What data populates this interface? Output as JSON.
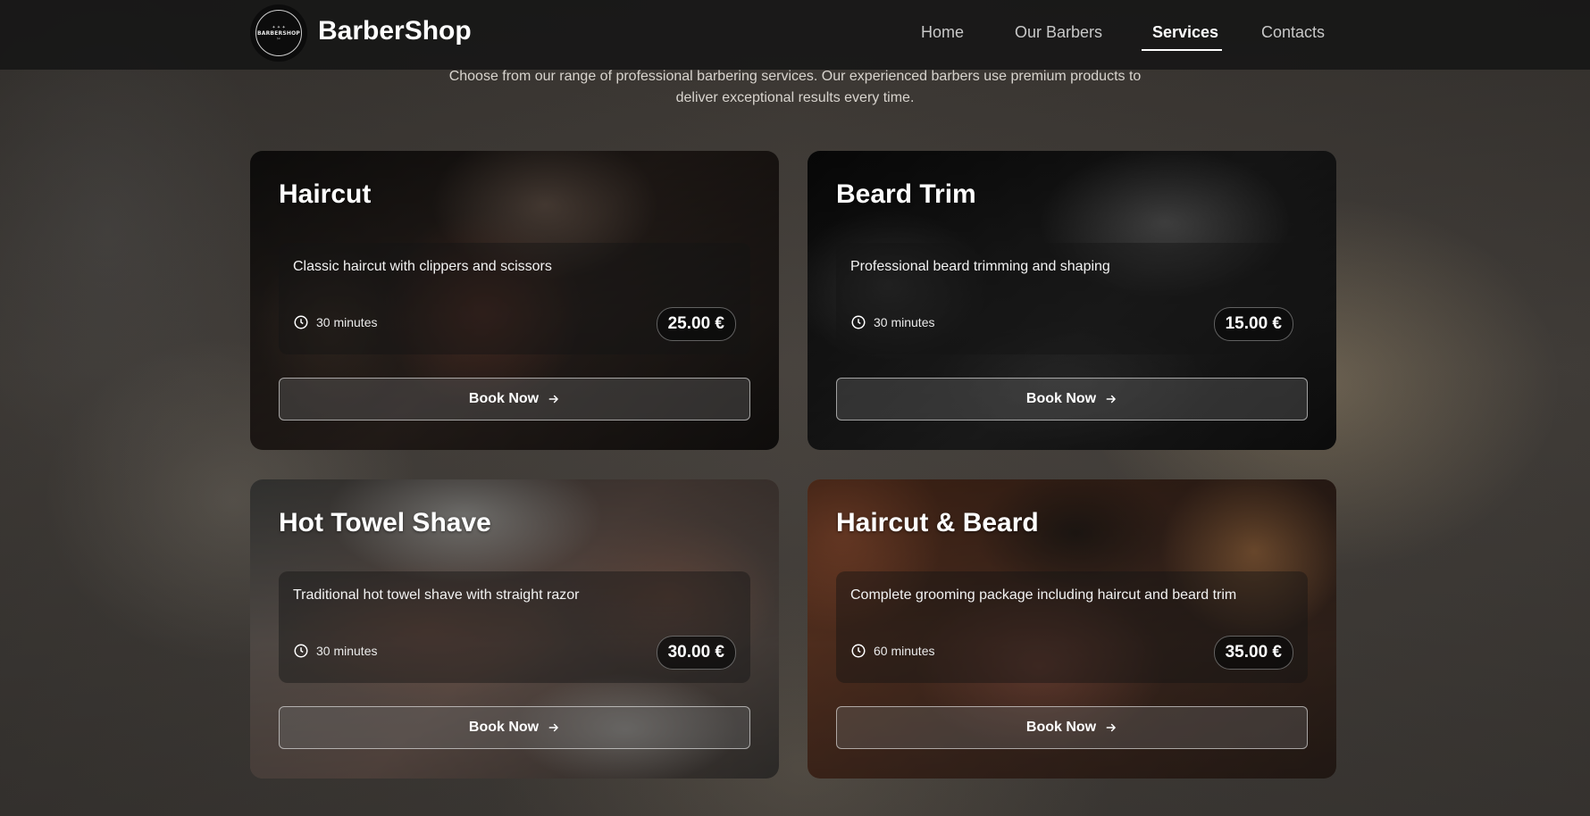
{
  "header": {
    "logo_text": "BARBERSHOP",
    "brand": "BarberShop",
    "nav": [
      {
        "label": "Home",
        "active": false
      },
      {
        "label": "Our Barbers",
        "active": false
      },
      {
        "label": "Services",
        "active": true
      },
      {
        "label": "Contacts",
        "active": false
      }
    ]
  },
  "intro": "Choose from our range of professional barbering services. Our experienced barbers use premium products to deliver exceptional results every time.",
  "services": [
    {
      "title": "Haircut",
      "description": "Classic haircut with clippers and scissors",
      "duration": "30 minutes",
      "price": "25.00 €",
      "button": "Book Now",
      "image_theme": "warm-dark"
    },
    {
      "title": "Beard Trim",
      "description": "Professional beard trimming and shaping",
      "duration": "30 minutes",
      "price": "15.00 €",
      "button": "Book Now",
      "image_theme": "monochrome"
    },
    {
      "title": "Hot Towel Shave",
      "description": "Traditional hot towel shave with straight razor",
      "duration": "30 minutes",
      "price": "30.00 €",
      "button": "Book Now",
      "image_theme": "light-skin"
    },
    {
      "title": "Haircut & Beard",
      "description": "Complete grooming package including haircut and beard trim",
      "duration": "60 minutes",
      "price": "35.00 €",
      "button": "Book Now",
      "image_theme": "warm-orange"
    }
  ],
  "colors": {
    "navbar": "#161616",
    "accent": "#ffffff",
    "nav_inactive": "#c8c8c8"
  },
  "icons": {
    "duration": "clock-icon",
    "button": "arrow-right-icon"
  }
}
